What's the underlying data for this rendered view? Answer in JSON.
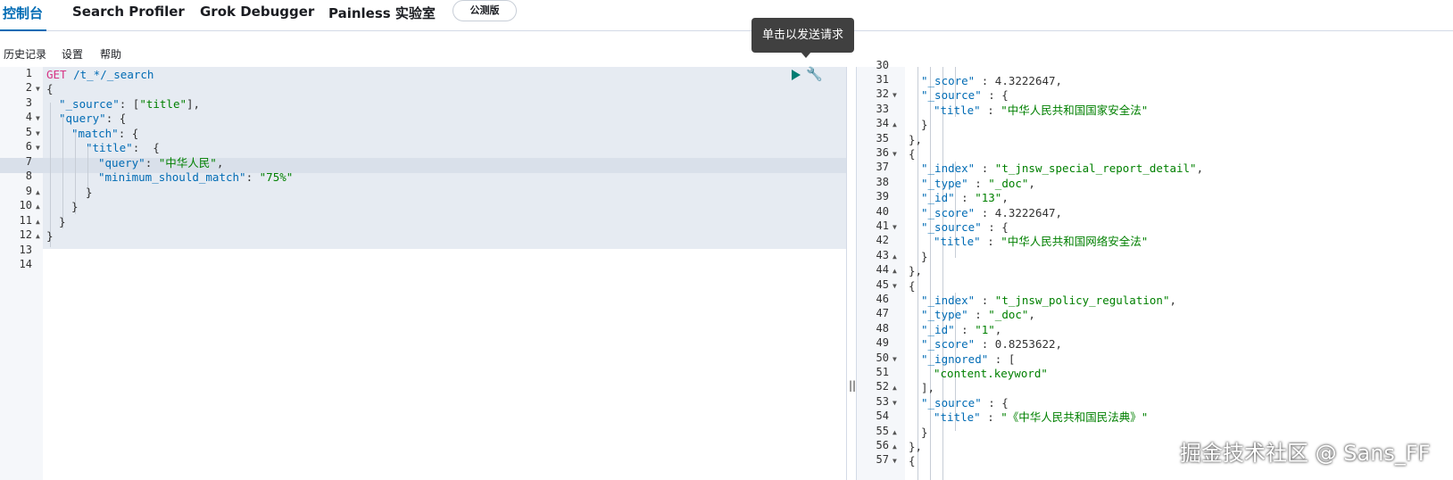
{
  "tabs": [
    {
      "label": "控制台",
      "active": true
    },
    {
      "label": "Search Profiler",
      "active": false
    },
    {
      "label": "Grok Debugger",
      "active": false
    },
    {
      "label": "Painless 实验室",
      "active": false
    }
  ],
  "beta_badge": "公测版",
  "menu": [
    "历史记录",
    "设置",
    "帮助"
  ],
  "tooltip": "单击以发送请求",
  "request_editor": {
    "line_numbers": [
      "1",
      "2",
      "3",
      "4",
      "5",
      "6",
      "7",
      "8",
      "9",
      "10",
      "11",
      "12",
      "13",
      "14"
    ],
    "method": "GET",
    "url": "/t_*/_search",
    "lines": {
      "l2": "{",
      "l3_key": "\"_source\"",
      "l3_rest": ": [",
      "l3_val": "\"title\"",
      "l3_end": "],",
      "l4_key": "\"query\"",
      "l4_rest": ": {",
      "l5_key": "\"match\"",
      "l5_rest": ": {",
      "l6_key": "\"title\"",
      "l6_rest": ":  {",
      "l7_key": "\"query\"",
      "l7_rest": ": ",
      "l7_val": "\"中华人民\"",
      "l7_end": ",",
      "l8_key": "\"minimum_should_match\"",
      "l8_rest": ": ",
      "l8_val": "\"75%\"",
      "l9": "}",
      "l10": "}",
      "l11": "}",
      "l12": "}"
    }
  },
  "response_editor": {
    "first_line_number": "30",
    "line_numbers": [
      "31",
      "32",
      "33",
      "34",
      "35",
      "36",
      "37",
      "38",
      "39",
      "40",
      "41",
      "42",
      "43",
      "44",
      "45",
      "46",
      "47",
      "48",
      "49",
      "50",
      "51",
      "52",
      "53",
      "54",
      "55",
      "56",
      "57"
    ],
    "rows": [
      {
        "key": "\"_score\"",
        "sep": " : ",
        "val": "4.3222647",
        "end": ",",
        "num": true
      },
      {
        "key": "\"_source\"",
        "sep": " : {",
        "val": "",
        "end": ""
      },
      {
        "key": "\"title\"",
        "sep": " : ",
        "val": "\"中华人民共和国国家安全法\"",
        "end": ""
      },
      {
        "key": "",
        "sep": "}",
        "val": "",
        "end": ""
      },
      {
        "key": "",
        "sep": "},",
        "val": "",
        "end": ""
      },
      {
        "key": "",
        "sep": "{",
        "val": "",
        "end": ""
      },
      {
        "key": "\"_index\"",
        "sep": " : ",
        "val": "\"t_jnsw_special_report_detail\"",
        "end": ","
      },
      {
        "key": "\"_type\"",
        "sep": " : ",
        "val": "\"_doc\"",
        "end": ","
      },
      {
        "key": "\"_id\"",
        "sep": " : ",
        "val": "\"13\"",
        "end": ","
      },
      {
        "key": "\"_score\"",
        "sep": " : ",
        "val": "4.3222647",
        "end": ",",
        "num": true
      },
      {
        "key": "\"_source\"",
        "sep": " : {",
        "val": "",
        "end": ""
      },
      {
        "key": "\"title\"",
        "sep": " : ",
        "val": "\"中华人民共和国网络安全法\"",
        "end": ""
      },
      {
        "key": "",
        "sep": "}",
        "val": "",
        "end": ""
      },
      {
        "key": "",
        "sep": "},",
        "val": "",
        "end": ""
      },
      {
        "key": "",
        "sep": "{",
        "val": "",
        "end": ""
      },
      {
        "key": "\"_index\"",
        "sep": " : ",
        "val": "\"t_jnsw_policy_regulation\"",
        "end": ","
      },
      {
        "key": "\"_type\"",
        "sep": " : ",
        "val": "\"_doc\"",
        "end": ","
      },
      {
        "key": "\"_id\"",
        "sep": " : ",
        "val": "\"1\"",
        "end": ","
      },
      {
        "key": "\"_score\"",
        "sep": " : ",
        "val": "0.8253622",
        "end": ",",
        "num": true
      },
      {
        "key": "\"_ignored\"",
        "sep": " : [",
        "val": "",
        "end": ""
      },
      {
        "key": "",
        "sep": "",
        "val": "\"content.keyword\"",
        "end": ""
      },
      {
        "key": "",
        "sep": "],",
        "val": "",
        "end": ""
      },
      {
        "key": "\"_source\"",
        "sep": " : {",
        "val": "",
        "end": ""
      },
      {
        "key": "\"title\"",
        "sep": " : ",
        "val": "\"《中华人民共和国民法典》\"",
        "end": ""
      },
      {
        "key": "",
        "sep": "}",
        "val": "",
        "end": ""
      },
      {
        "key": "",
        "sep": "},",
        "val": "",
        "end": ""
      },
      {
        "key": "",
        "sep": "{",
        "val": "",
        "end": ""
      }
    ]
  },
  "resize_handle": "||",
  "watermark": "掘金技术社区 @ Sans_FF",
  "colors": {
    "accent": "#006bb4",
    "string": "#008000",
    "play": "#017d73"
  }
}
